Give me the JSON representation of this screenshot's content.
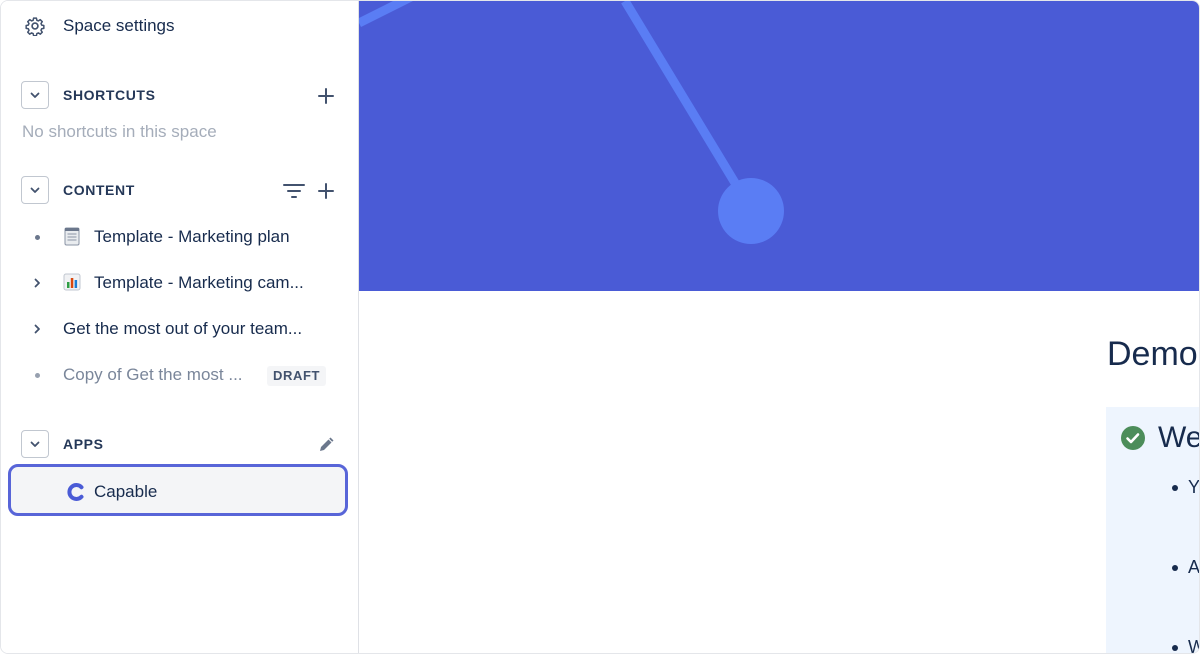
{
  "sidebar": {
    "space_settings": "Space settings",
    "shortcuts": {
      "title": "SHORTCUTS",
      "empty_text": "No shortcuts in this space"
    },
    "content": {
      "title": "CONTENT",
      "items": [
        {
          "emoji": "notepad-icon",
          "label": "Template - Marketing plan"
        },
        {
          "emoji": "bar-chart-icon",
          "label": "Template - Marketing cam..."
        },
        {
          "label": "Get the most out of your team..."
        },
        {
          "label": "Copy of Get the most ...",
          "badge": "DRAFT"
        }
      ]
    },
    "apps": {
      "title": "APPS",
      "items": [
        {
          "label": "Capable",
          "icon": "capable-logo-icon"
        }
      ]
    }
  },
  "main": {
    "title": "Demo",
    "panel": {
      "heading": "We",
      "bullets": [
        "Y",
        "A",
        "W"
      ]
    }
  },
  "colors": {
    "banner": "#4a5bd6",
    "banner_graphic": "#5a7df4",
    "selection_border": "#5865d8",
    "check": "#4c8d5a"
  }
}
